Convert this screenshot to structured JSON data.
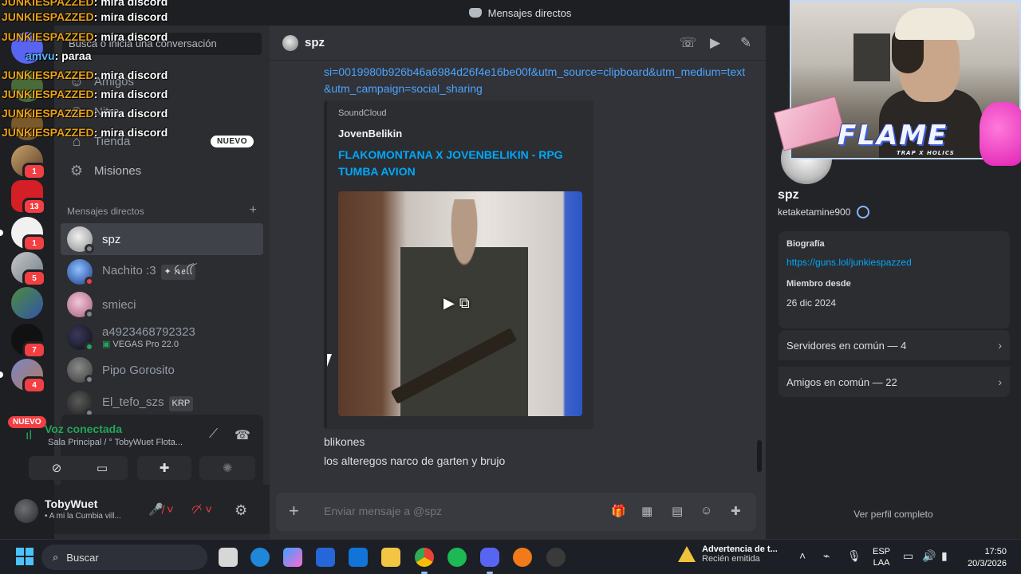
{
  "window": {
    "title": "Mensajes directos"
  },
  "sidebar": {
    "search_placeholder": "Busca o inicia una conversación",
    "nav": [
      {
        "label": "Amigos"
      },
      {
        "label": "Nitro"
      },
      {
        "label": "Tienda",
        "badge": "NUEVO"
      },
      {
        "label": "Misiones"
      }
    ],
    "dm_header": "Mensajes directos",
    "dms": [
      {
        "name": "spz",
        "active": true
      },
      {
        "name": "Nachito :3",
        "tag": "✦ ꫝꫀꪶꪶ"
      },
      {
        "name": "smieci"
      },
      {
        "name": "a4923468792323",
        "status": "VEGAS Pro 22.0"
      },
      {
        "name": "Pipo Gorosito"
      },
      {
        "name": "El_tefo_szs",
        "tag": "KRP"
      }
    ]
  },
  "servers": {
    "badges": [
      "1",
      "13",
      "1",
      "5",
      "7",
      "4"
    ],
    "new_label": "NUEVO"
  },
  "voice": {
    "title": "Voz conectada",
    "channel": "Sala Principal / ° TobyWuet Flota..."
  },
  "user": {
    "name": "TobyWuet",
    "status": "• A mi la Cumbia vill..."
  },
  "chat": {
    "header_name": "spz",
    "link_text": "si=0019980b926b46a6984d26f4e16be00f&utm_source=clipboard&utm_medium=text&utm_campaign=social_sharing",
    "embed": {
      "provider": "SoundCloud",
      "author": "JovenBelikin",
      "title": "FLAKOMONTANA X JOVENBELIKIN - RPG TUMBA AVION"
    },
    "messages": [
      "blikones",
      "los alteregos narco de garten y brujo"
    ],
    "composer_placeholder": "Enviar mensaje a @spz"
  },
  "profile": {
    "display_name": "spz",
    "username": "ketaketamine900",
    "bio_label": "Biografía",
    "bio_link": "https://guns.lol/junkiespazzed",
    "member_since_label": "Miembro desde",
    "member_since": "26 dic 2024",
    "mutual_servers": "Servidores en común — 4",
    "mutual_friends": "Amigos en común — 22",
    "view_full": "Ver perfil completo"
  },
  "overlay": {
    "lines": [
      {
        "user": "JUNKIESPAZZED",
        "text": "mira discord"
      },
      {
        "user": "JUNKIESPAZZED",
        "text": "mira discord"
      },
      {
        "user": "JUNKIESPAZZED",
        "text": "mira discord"
      },
      {
        "user": "amvu",
        "text": "paraa"
      },
      {
        "user": "JUNKIESPAZZED",
        "text": "mira discord"
      },
      {
        "user": "JUNKIESPAZZED",
        "text": "mira discord"
      },
      {
        "user": "JUNKIESPAZZED",
        "text": "mira discord"
      },
      {
        "user": "JUNKIESPAZZED",
        "text": "mira discord"
      }
    ]
  },
  "stream_overlay": {
    "logo_text": "FLAME",
    "logo_sub": "TRAP X HOLICS"
  },
  "taskbar": {
    "search_label": "Buscar",
    "warning_title": "Advertencia de t...",
    "warning_sub": "Recién emitida",
    "lang_top": "ESP",
    "lang_bottom": "LAA",
    "time": "17:50",
    "date": "20/3/2026"
  },
  "colors": {
    "accent_link": "#00a8fc",
    "online": "#23a55a",
    "danger": "#f23f43",
    "overlay_user": "#e9a116"
  }
}
